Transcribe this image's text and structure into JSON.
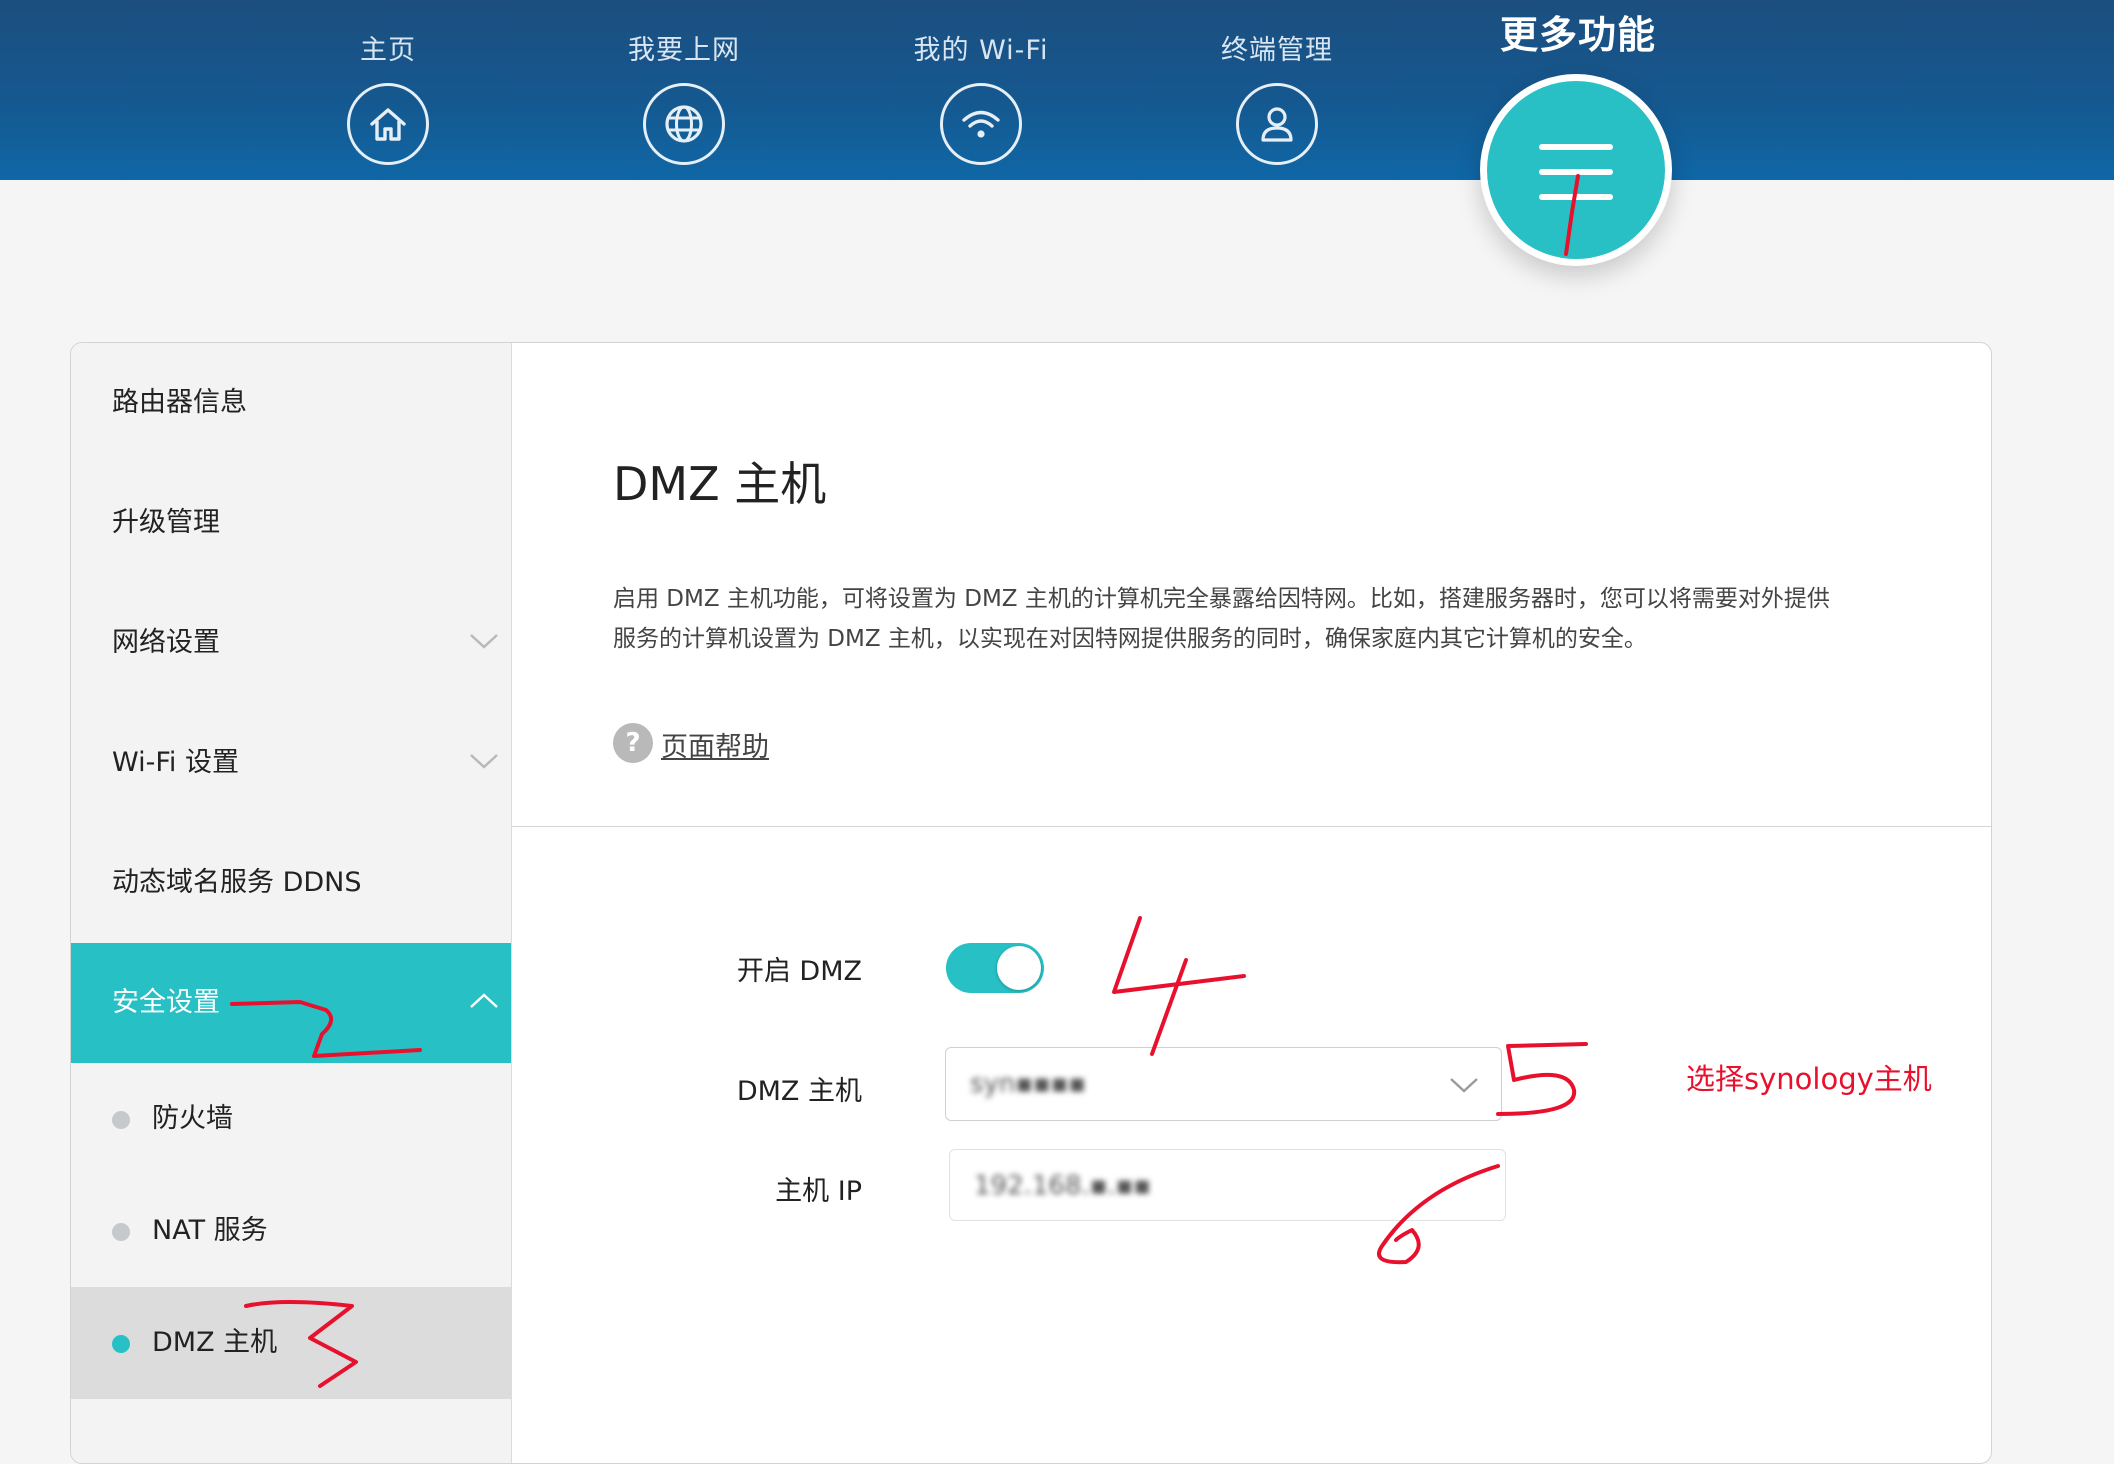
{
  "nav": {
    "items": [
      {
        "label": "主页",
        "icon": "home-icon"
      },
      {
        "label": "我要上网",
        "icon": "globe-icon"
      },
      {
        "label": "我的 Wi-Fi",
        "icon": "wifi-icon"
      },
      {
        "label": "终端管理",
        "icon": "user-icon"
      }
    ],
    "more": {
      "label": "更多功能",
      "icon": "menu-icon"
    }
  },
  "sidebar": {
    "items": [
      {
        "label": "路由器信息"
      },
      {
        "label": "升级管理"
      },
      {
        "label": "网络设置",
        "chevron": "chevron-down-icon"
      },
      {
        "label": "Wi-Fi 设置",
        "chevron": "chevron-down-icon"
      },
      {
        "label": "动态域名服务 DDNS"
      },
      {
        "label": "安全设置",
        "chevron": "chevron-up-icon",
        "active": true
      }
    ],
    "subitems": [
      {
        "label": "防火墙"
      },
      {
        "label": "NAT 服务"
      },
      {
        "label": "DMZ 主机",
        "selected": true
      }
    ]
  },
  "main": {
    "title": "DMZ 主机",
    "description_line1": "启用 DMZ 主机功能，可将设置为 DMZ 主机的计算机完全暴露给因特网。比如，搭建服务器时，您可以将需要对外提供",
    "description_line2": "服务的计算机设置为 DMZ 主机，以实现在对因特网提供服务的同时，确保家庭内其它计算机的安全。",
    "help_label": "页面帮助",
    "form": {
      "enable_label": "开启 DMZ",
      "enabled": true,
      "host_label": "DMZ 主机",
      "host_value": "syn▪▪▪▪",
      "ip_label": "主机 IP",
      "ip_value": "192.168.▪.▪▪"
    }
  },
  "annotations": {
    "note": "选择synology主机",
    "color": "#e8112d"
  },
  "colors": {
    "accent": "#27c0c5",
    "nav_bg": "#15588f"
  }
}
